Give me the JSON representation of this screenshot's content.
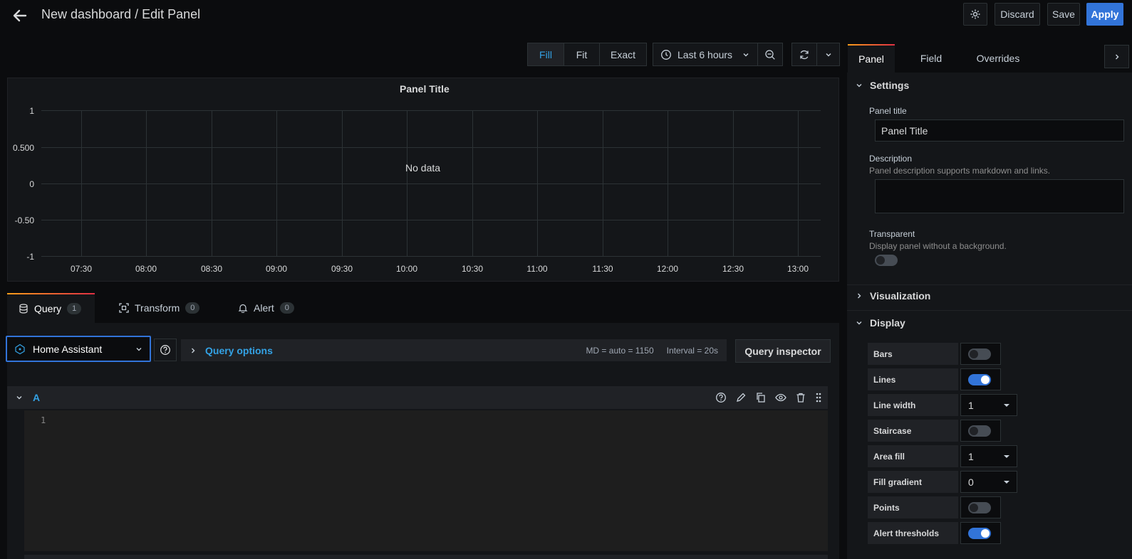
{
  "header": {
    "title": "New dashboard / Edit Panel",
    "discard_label": "Discard",
    "save_label": "Save",
    "apply_label": "Apply"
  },
  "toolbar": {
    "fill_label": "Fill",
    "fit_label": "Fit",
    "exact_label": "Exact",
    "time_range": "Last 6 hours"
  },
  "panel": {
    "title": "Panel Title",
    "no_data": "No data",
    "y_ticks": [
      "1",
      "0.500",
      "0",
      "-0.50",
      "-1"
    ],
    "x_ticks": [
      "07:30",
      "08:00",
      "08:30",
      "09:00",
      "09:30",
      "10:00",
      "10:30",
      "11:00",
      "11:30",
      "12:00",
      "12:30",
      "13:00"
    ]
  },
  "query_tabs": [
    {
      "label": "Query",
      "count": "1"
    },
    {
      "label": "Transform",
      "count": "0"
    },
    {
      "label": "Alert",
      "count": "0"
    }
  ],
  "query": {
    "datasource": "Home Assistant",
    "options_label": "Query options",
    "md_info": "MD = auto = 1150",
    "interval_info": "Interval = 20s",
    "inspector_label": "Query inspector",
    "row_ref": "A",
    "line_number": "1"
  },
  "right_panel": {
    "tabs": [
      "Panel",
      "Field",
      "Overrides"
    ],
    "settings": {
      "header": "Settings",
      "panel_title_label": "Panel title",
      "panel_title_value": "Panel Title",
      "description_label": "Description",
      "description_help": "Panel description supports markdown and links.",
      "transparent_label": "Transparent",
      "transparent_help": "Display panel without a background."
    },
    "visualization_header": "Visualization",
    "display_header": "Display",
    "display_options": {
      "bars": {
        "label": "Bars",
        "on": false
      },
      "lines": {
        "label": "Lines",
        "on": true
      },
      "line_width": {
        "label": "Line width",
        "value": "1"
      },
      "staircase": {
        "label": "Staircase",
        "on": false
      },
      "area_fill": {
        "label": "Area fill",
        "value": "1"
      },
      "fill_gradient": {
        "label": "Fill gradient",
        "value": "0"
      },
      "points": {
        "label": "Points",
        "on": false
      },
      "alert_thresholds": {
        "label": "Alert thresholds",
        "on": true
      }
    }
  },
  "colors": {
    "accent": "#3274d9",
    "link": "#33a2e5",
    "background": "#0b0c0e",
    "panel": "#141619"
  }
}
